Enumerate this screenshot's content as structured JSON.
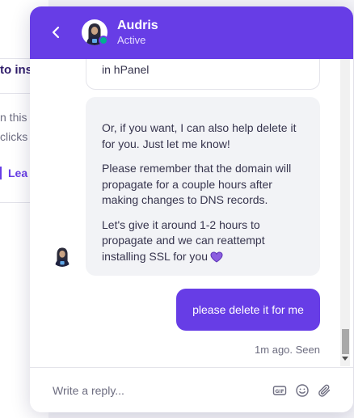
{
  "background_page": {
    "heading": "to ins",
    "text_line_1": "n this",
    "text_line_2": "clicks",
    "link": "Lea"
  },
  "header": {
    "agent_name": "Audris",
    "agent_status": "Active",
    "accent_color": "#673de6",
    "status_dot_color": "#00b090"
  },
  "messages": {
    "partial_bubble_text": "in hPanel",
    "agent_paragraphs": [
      "Or, if you want, I can also help delete it for you. Just let me know!",
      "Please remember that the domain will propagate for a couple hours after making changes to DNS records.",
      "Let's give it around 1-2 hours to propagate and we can reattempt installing SSL for you"
    ],
    "user_message": "please delete it for me",
    "meta": "1m ago. Seen"
  },
  "composer": {
    "placeholder": "Write a reply...",
    "tools": [
      "gif-icon",
      "emoji-icon",
      "attachment-icon"
    ]
  }
}
